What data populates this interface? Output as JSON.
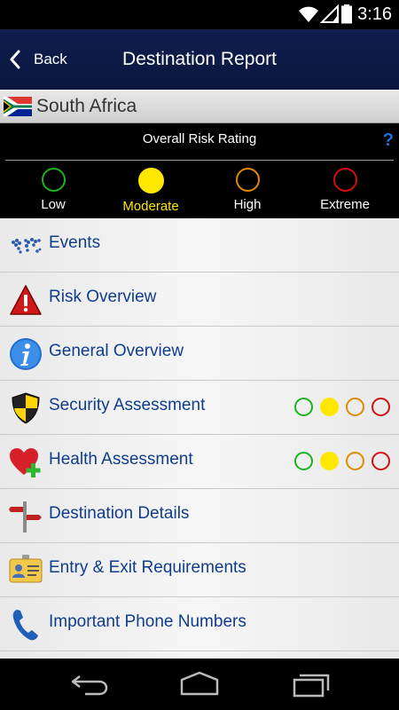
{
  "status_bar": {
    "time": "3:16"
  },
  "app_bar": {
    "back_label": "Back",
    "title": "Destination Report"
  },
  "country": {
    "name": "South Africa"
  },
  "risk_panel": {
    "title": "Overall Risk Rating",
    "help": "?",
    "levels": [
      {
        "label": "Low",
        "color": "#1db31d"
      },
      {
        "label": "Moderate",
        "color": "#ffe800"
      },
      {
        "label": "High",
        "color": "#e08a00"
      },
      {
        "label": "Extreme",
        "color": "#d01010"
      }
    ],
    "selected": "Moderate"
  },
  "menu": {
    "items": [
      {
        "label": "Events",
        "icon": "world-map-icon"
      },
      {
        "label": "Risk Overview",
        "icon": "warning-icon"
      },
      {
        "label": "General Overview",
        "icon": "info-icon"
      },
      {
        "label": "Security Assessment",
        "icon": "shield-icon",
        "rating": "Moderate"
      },
      {
        "label": "Health Assessment",
        "icon": "heart-plus-icon",
        "rating": "Moderate"
      },
      {
        "label": "Destination Details",
        "icon": "signpost-icon"
      },
      {
        "label": "Entry & Exit Requirements",
        "icon": "id-card-icon"
      },
      {
        "label": "Important Phone Numbers",
        "icon": "phone-icon"
      }
    ]
  },
  "colors": {
    "app_bar": "#0f1e4d",
    "menu_text": "#0f3d8c",
    "low": "#1db31d",
    "moderate": "#ffe800",
    "high": "#e08a00",
    "extreme": "#d01010"
  }
}
